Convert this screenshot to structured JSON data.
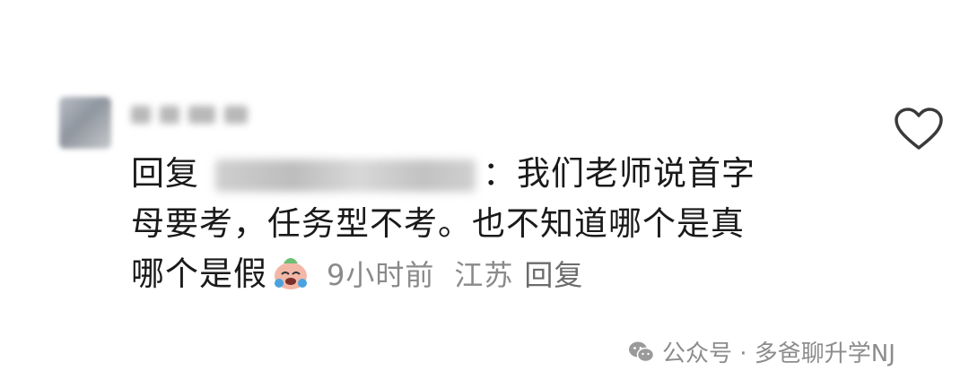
{
  "comment": {
    "reply_prefix": "回复",
    "colon": "：",
    "line1_text": "我们老师说首字",
    "line2_text": "母要考，任务型不考。也不知道哪个是真",
    "line3_text": "哪个是假",
    "emoji_icon": "crying-laughing-emoji-icon",
    "time": "9小时前",
    "location": "江苏",
    "reply_label": "回复"
  },
  "like_icon": "heart-outline-icon",
  "watermark": {
    "icon": "wechat-icon",
    "text": "公众号 · 多爸聊升学NJ"
  }
}
